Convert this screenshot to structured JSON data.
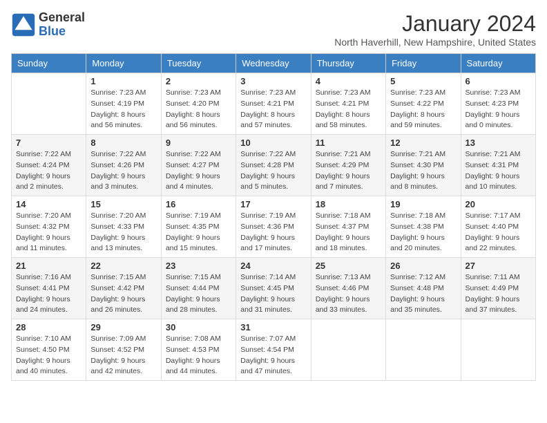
{
  "logo": {
    "general": "General",
    "blue": "Blue"
  },
  "title": "January 2024",
  "location": "North Haverhill, New Hampshire, United States",
  "days_of_week": [
    "Sunday",
    "Monday",
    "Tuesday",
    "Wednesday",
    "Thursday",
    "Friday",
    "Saturday"
  ],
  "weeks": [
    [
      {
        "day": "",
        "info": ""
      },
      {
        "day": "1",
        "info": "Sunrise: 7:23 AM\nSunset: 4:19 PM\nDaylight: 8 hours\nand 56 minutes."
      },
      {
        "day": "2",
        "info": "Sunrise: 7:23 AM\nSunset: 4:20 PM\nDaylight: 8 hours\nand 56 minutes."
      },
      {
        "day": "3",
        "info": "Sunrise: 7:23 AM\nSunset: 4:21 PM\nDaylight: 8 hours\nand 57 minutes."
      },
      {
        "day": "4",
        "info": "Sunrise: 7:23 AM\nSunset: 4:21 PM\nDaylight: 8 hours\nand 58 minutes."
      },
      {
        "day": "5",
        "info": "Sunrise: 7:23 AM\nSunset: 4:22 PM\nDaylight: 8 hours\nand 59 minutes."
      },
      {
        "day": "6",
        "info": "Sunrise: 7:23 AM\nSunset: 4:23 PM\nDaylight: 9 hours\nand 0 minutes."
      }
    ],
    [
      {
        "day": "7",
        "info": "Sunrise: 7:22 AM\nSunset: 4:24 PM\nDaylight: 9 hours\nand 2 minutes."
      },
      {
        "day": "8",
        "info": "Sunrise: 7:22 AM\nSunset: 4:26 PM\nDaylight: 9 hours\nand 3 minutes."
      },
      {
        "day": "9",
        "info": "Sunrise: 7:22 AM\nSunset: 4:27 PM\nDaylight: 9 hours\nand 4 minutes."
      },
      {
        "day": "10",
        "info": "Sunrise: 7:22 AM\nSunset: 4:28 PM\nDaylight: 9 hours\nand 5 minutes."
      },
      {
        "day": "11",
        "info": "Sunrise: 7:21 AM\nSunset: 4:29 PM\nDaylight: 9 hours\nand 7 minutes."
      },
      {
        "day": "12",
        "info": "Sunrise: 7:21 AM\nSunset: 4:30 PM\nDaylight: 9 hours\nand 8 minutes."
      },
      {
        "day": "13",
        "info": "Sunrise: 7:21 AM\nSunset: 4:31 PM\nDaylight: 9 hours\nand 10 minutes."
      }
    ],
    [
      {
        "day": "14",
        "info": "Sunrise: 7:20 AM\nSunset: 4:32 PM\nDaylight: 9 hours\nand 11 minutes."
      },
      {
        "day": "15",
        "info": "Sunrise: 7:20 AM\nSunset: 4:33 PM\nDaylight: 9 hours\nand 13 minutes."
      },
      {
        "day": "16",
        "info": "Sunrise: 7:19 AM\nSunset: 4:35 PM\nDaylight: 9 hours\nand 15 minutes."
      },
      {
        "day": "17",
        "info": "Sunrise: 7:19 AM\nSunset: 4:36 PM\nDaylight: 9 hours\nand 17 minutes."
      },
      {
        "day": "18",
        "info": "Sunrise: 7:18 AM\nSunset: 4:37 PM\nDaylight: 9 hours\nand 18 minutes."
      },
      {
        "day": "19",
        "info": "Sunrise: 7:18 AM\nSunset: 4:38 PM\nDaylight: 9 hours\nand 20 minutes."
      },
      {
        "day": "20",
        "info": "Sunrise: 7:17 AM\nSunset: 4:40 PM\nDaylight: 9 hours\nand 22 minutes."
      }
    ],
    [
      {
        "day": "21",
        "info": "Sunrise: 7:16 AM\nSunset: 4:41 PM\nDaylight: 9 hours\nand 24 minutes."
      },
      {
        "day": "22",
        "info": "Sunrise: 7:15 AM\nSunset: 4:42 PM\nDaylight: 9 hours\nand 26 minutes."
      },
      {
        "day": "23",
        "info": "Sunrise: 7:15 AM\nSunset: 4:44 PM\nDaylight: 9 hours\nand 28 minutes."
      },
      {
        "day": "24",
        "info": "Sunrise: 7:14 AM\nSunset: 4:45 PM\nDaylight: 9 hours\nand 31 minutes."
      },
      {
        "day": "25",
        "info": "Sunrise: 7:13 AM\nSunset: 4:46 PM\nDaylight: 9 hours\nand 33 minutes."
      },
      {
        "day": "26",
        "info": "Sunrise: 7:12 AM\nSunset: 4:48 PM\nDaylight: 9 hours\nand 35 minutes."
      },
      {
        "day": "27",
        "info": "Sunrise: 7:11 AM\nSunset: 4:49 PM\nDaylight: 9 hours\nand 37 minutes."
      }
    ],
    [
      {
        "day": "28",
        "info": "Sunrise: 7:10 AM\nSunset: 4:50 PM\nDaylight: 9 hours\nand 40 minutes."
      },
      {
        "day": "29",
        "info": "Sunrise: 7:09 AM\nSunset: 4:52 PM\nDaylight: 9 hours\nand 42 minutes."
      },
      {
        "day": "30",
        "info": "Sunrise: 7:08 AM\nSunset: 4:53 PM\nDaylight: 9 hours\nand 44 minutes."
      },
      {
        "day": "31",
        "info": "Sunrise: 7:07 AM\nSunset: 4:54 PM\nDaylight: 9 hours\nand 47 minutes."
      },
      {
        "day": "",
        "info": ""
      },
      {
        "day": "",
        "info": ""
      },
      {
        "day": "",
        "info": ""
      }
    ]
  ]
}
